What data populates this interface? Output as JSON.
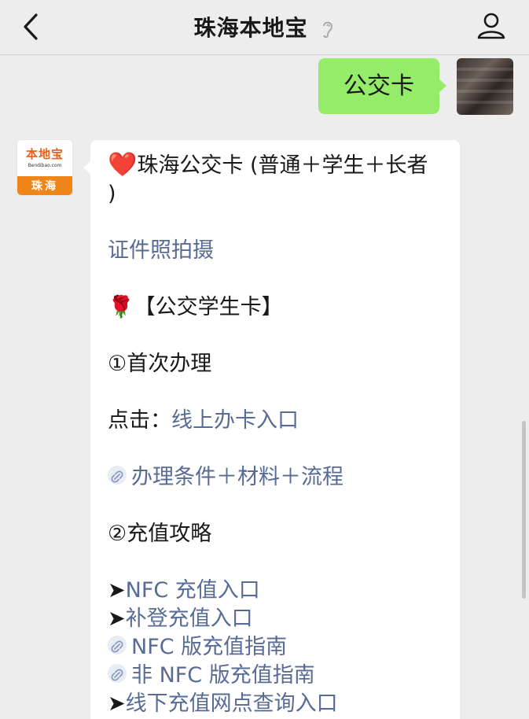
{
  "header": {
    "title": "珠海本地宝",
    "back_icon": "chevron-left-icon",
    "ear_icon": "ear-icon",
    "profile_icon": "user-icon"
  },
  "outgoing": {
    "text": "公交卡",
    "bubble_color": "#95ec69"
  },
  "bot_avatar": {
    "logo_main": "本地宝",
    "logo_sub": "Bendibao.com",
    "city": "珠海"
  },
  "incoming": {
    "title_emoji": "❤️",
    "title": "珠海公交卡 (普通＋学生＋长者",
    "title_end": ")",
    "link_photo": "证件照拍摄",
    "rose": "🌹",
    "section_student": "【公交学生卡】",
    "first_time": "①首次办理",
    "click_label": "点击：",
    "online_link": "线上办卡入口",
    "conditions_link": "办理条件＋材料＋流程",
    "recharge": "②充值攻略",
    "arrow": "➤",
    "nfc_entry": "NFC 充值入口",
    "supplement_entry": "补登充值入口",
    "nfc_guide": "NFC 版充值指南",
    "non_nfc_guide": "非 NFC 版充值指南",
    "offline_entry": "线下充值网点查询入口",
    "link_color": "#576b95"
  }
}
